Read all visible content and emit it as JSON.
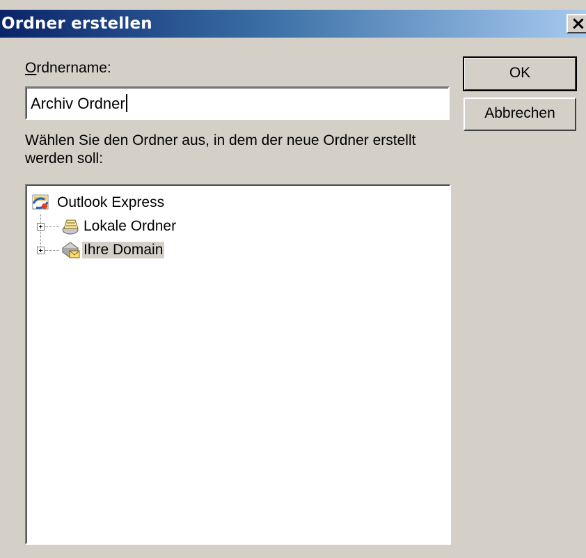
{
  "dialog": {
    "title": "Ordner erstellen",
    "close_glyph": "×"
  },
  "form": {
    "name_label_accel": "O",
    "name_label_rest": "rdnername:",
    "name_value": "Archiv Ordner",
    "instruction_line1": "Wählen Sie den Ordner aus, in dem der neue Ordner erstellt",
    "instruction_line2": "werden soll:"
  },
  "buttons": {
    "ok_label": "OK",
    "cancel_label": "Abbrechen"
  },
  "tree": {
    "root_label": "Outlook Express",
    "items": [
      {
        "label": "Lokale Ordner",
        "icon": "local-folders-icon"
      },
      {
        "label": "Ihre Domain",
        "icon": "mail-server-icon",
        "selected": true
      }
    ]
  }
}
